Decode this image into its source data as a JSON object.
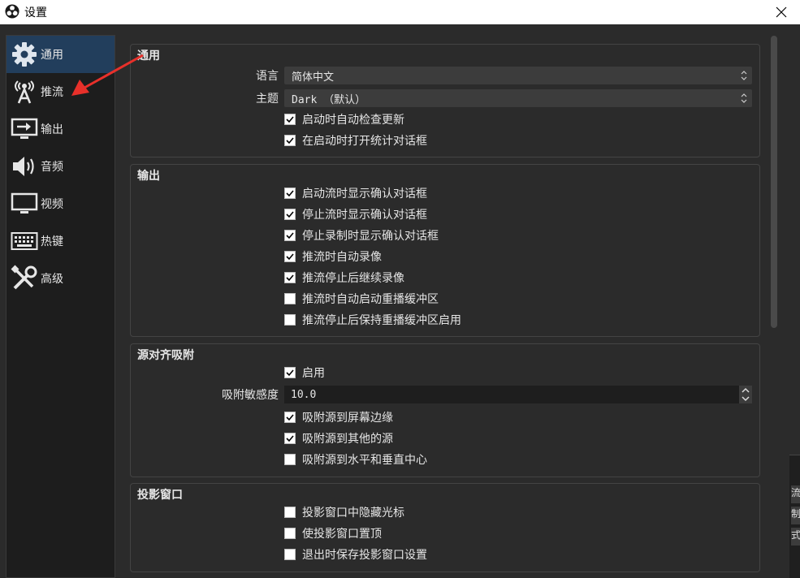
{
  "window": {
    "title": "设置"
  },
  "sidebar": {
    "items": [
      {
        "label": "通用",
        "icon": "gear-icon",
        "active": true
      },
      {
        "label": "推流",
        "icon": "broadcast-antenna-icon",
        "active": false
      },
      {
        "label": "输出",
        "icon": "monitor-output-icon",
        "active": false
      },
      {
        "label": "音频",
        "icon": "speaker-icon",
        "active": false
      },
      {
        "label": "视频",
        "icon": "monitor-icon",
        "active": false
      },
      {
        "label": "热键",
        "icon": "keyboard-icon",
        "active": false
      },
      {
        "label": "高级",
        "icon": "tools-icon",
        "active": false
      }
    ]
  },
  "general": {
    "title": "通用",
    "language_label": "语言",
    "language_value": "简体中文",
    "theme_label": "主题",
    "theme_value": "Dark （默认）",
    "checks": [
      {
        "label": "启动时自动检查更新",
        "checked": true
      },
      {
        "label": "在启动时打开统计对话框",
        "checked": true
      }
    ]
  },
  "output": {
    "title": "输出",
    "checks": [
      {
        "label": "启动流时显示确认对话框",
        "checked": true
      },
      {
        "label": "停止流时显示确认对话框",
        "checked": true
      },
      {
        "label": "停止录制时显示确认对话框",
        "checked": true
      },
      {
        "label": "推流时自动录像",
        "checked": true
      },
      {
        "label": "推流停止后继续录像",
        "checked": true
      },
      {
        "label": "推流时自动启动重播缓冲区",
        "checked": false
      },
      {
        "label": "推流停止后保持重播缓冲区启用",
        "checked": false
      }
    ]
  },
  "snapping": {
    "title": "源对齐吸附",
    "enable": {
      "label": "启用",
      "checked": true
    },
    "sensitivity_label": "吸附敏感度",
    "sensitivity_value": "10.0",
    "checks": [
      {
        "label": "吸附源到屏幕边缘",
        "checked": true
      },
      {
        "label": "吸附源到其他的源",
        "checked": true
      },
      {
        "label": "吸附源到水平和垂直中心",
        "checked": false
      }
    ]
  },
  "projectors": {
    "title": "投影窗口",
    "checks": [
      {
        "label": "投影窗口中隐藏光标",
        "checked": false
      },
      {
        "label": "使投影窗口置顶",
        "checked": false
      },
      {
        "label": "退出时保存投影窗口设置",
        "checked": false
      }
    ]
  },
  "right_strip": {
    "buttons": [
      "流",
      "制",
      "式"
    ]
  },
  "colors": {
    "background": "#2b2b2b",
    "sidebar": "#1d1d1d",
    "active_item": "#223e5c",
    "annotation_arrow": "#e8302a"
  }
}
